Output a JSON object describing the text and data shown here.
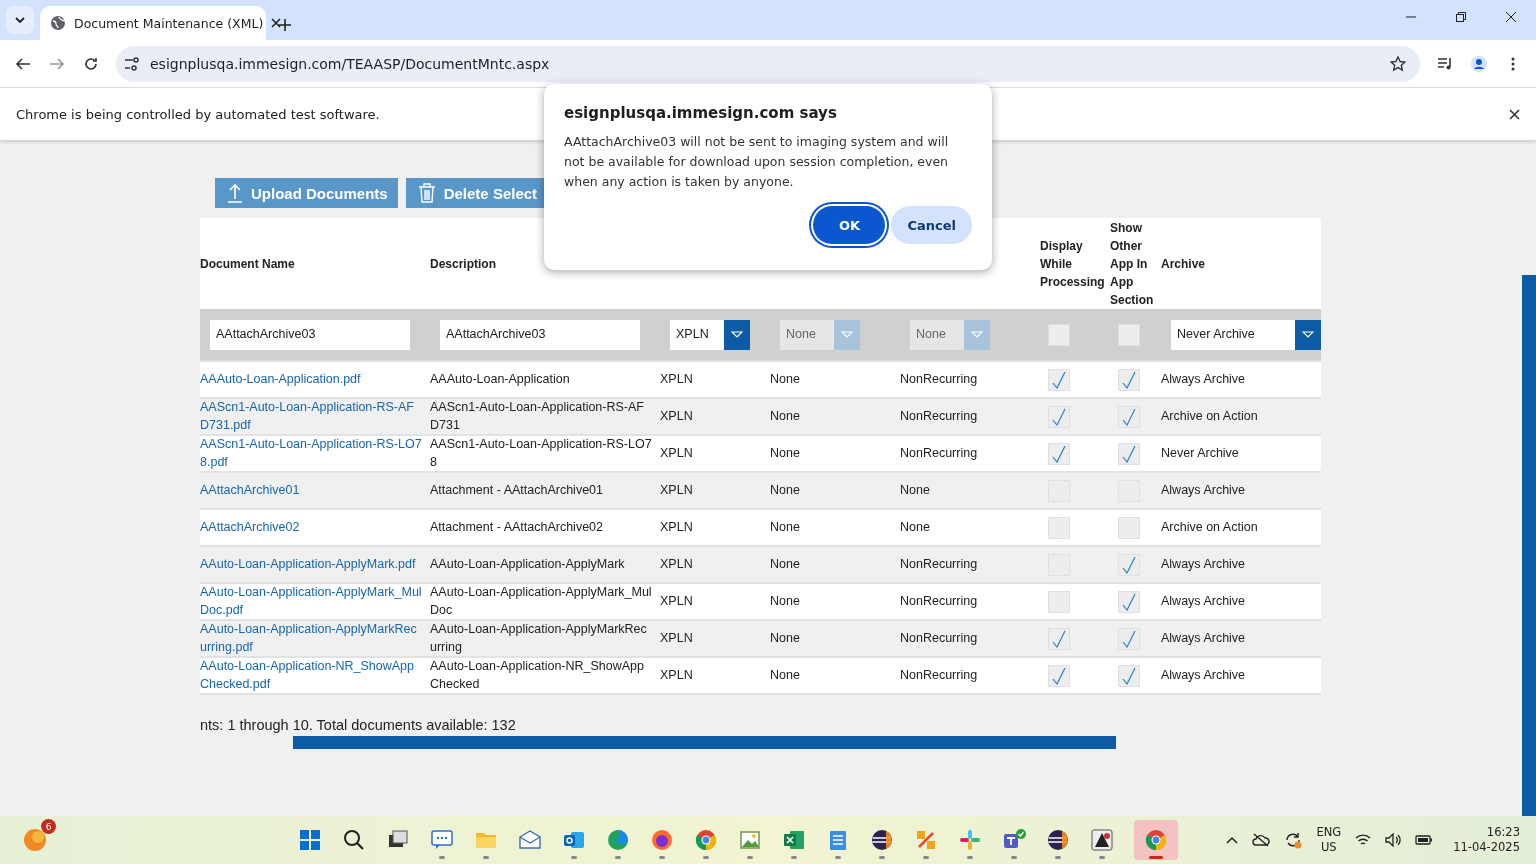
{
  "browser": {
    "tab_title": "Document Maintenance (XML)",
    "address": "esignplusqa.immesign.com/TEAASP/DocumentMntc.aspx",
    "infobar": "Chrome is being controlled by automated test software."
  },
  "actions": [
    {
      "label": "Upload Documents",
      "kind": "upload"
    },
    {
      "label": "Delete Select",
      "kind": "delete"
    }
  ],
  "table": {
    "columns": [
      {
        "label": "Document Name"
      },
      {
        "label": "Description"
      },
      {},
      {},
      {},
      {
        "label": "Display While Processing"
      },
      {
        "label": "Show Other App In App Section"
      },
      {
        "label": "Archive"
      }
    ],
    "filter": {
      "name": "AAttachArchive03",
      "description": "AAttachArchive03",
      "type": {
        "value": "XPLN",
        "disabled": false
      },
      "column_4": {
        "value": "None",
        "disabled": true
      },
      "column_5": {
        "value": "None",
        "disabled": true
      },
      "display": false,
      "show_other": false,
      "archive": {
        "value": "Never Archive",
        "disabled": false
      }
    },
    "rows": [
      {
        "name": "AAAuto-Loan-Application.pdf",
        "description": "AAAuto-Loan-Application",
        "type": "XPLN",
        "column_4": "None",
        "column_5": "NonRecurring",
        "display": true,
        "show_other": true,
        "archive": "Always Archive"
      },
      {
        "name": "AAScn1-Auto-Loan-Application-RS-AFD731.pdf",
        "description": "AAScn1-Auto-Loan-Application-RS-AFD731",
        "type": "XPLN",
        "column_4": "None",
        "column_5": "NonRecurring",
        "display": true,
        "show_other": true,
        "archive": "Archive on Action"
      },
      {
        "name": "AAScn1-Auto-Loan-Application-RS-LO78.pdf",
        "description": "AAScn1-Auto-Loan-Application-RS-LO78",
        "type": "XPLN",
        "column_4": "None",
        "column_5": "NonRecurring",
        "display": true,
        "show_other": true,
        "archive": "Never Archive"
      },
      {
        "name": "AAttachArchive01",
        "description": "Attachment - AAttachArchive01",
        "type": "XPLN",
        "column_4": "None",
        "column_5": "None",
        "display": false,
        "show_other": false,
        "archive": "Always Archive"
      },
      {
        "name": "AAttachArchive02",
        "description": "Attachment - AAttachArchive02",
        "type": "XPLN",
        "column_4": "None",
        "column_5": "None",
        "display": false,
        "show_other": false,
        "archive": "Archive on Action"
      },
      {
        "name": "AAuto-Loan-Application-ApplyMark.pdf",
        "description": "AAuto-Loan-Application-ApplyMark",
        "type": "XPLN",
        "column_4": "None",
        "column_5": "NonRecurring",
        "display": false,
        "show_other": true,
        "archive": "Always Archive"
      },
      {
        "name": "AAuto-Loan-Application-ApplyMark_MulDoc.pdf",
        "description": "AAuto-Loan-Application-ApplyMark_MulDoc",
        "type": "XPLN",
        "column_4": "None",
        "column_5": "NonRecurring",
        "display": false,
        "show_other": true,
        "archive": "Always Archive"
      },
      {
        "name": "AAuto-Loan-Application-ApplyMarkRecurring.pdf",
        "description": "AAuto-Loan-Application-ApplyMarkRecurring",
        "type": "XPLN",
        "column_4": "None",
        "column_5": "NonRecurring",
        "display": true,
        "show_other": true,
        "archive": "Always Archive"
      },
      {
        "name": "AAuto-Loan-Application-NR_ShowAppChecked.pdf",
        "description": "AAuto-Loan-Application-NR_ShowAppChecked",
        "type": "XPLN",
        "column_4": "None",
        "column_5": "NonRecurring",
        "display": true,
        "show_other": true,
        "archive": "Always Archive"
      }
    ]
  },
  "footer": "nts: 1 through 10. Total documents available: 132",
  "dialog": {
    "title": "esignplusqa.immesign.com says",
    "message": "AAttachArchive03 will not be sent to imaging system and will not be available for download upon session completion, even when any action is taken by anyone.",
    "buttons": [
      {
        "label": "OK",
        "selected": true
      },
      {
        "label": "Cancel",
        "selected": false
      }
    ]
  },
  "taskbar": {
    "notification_badge": "6",
    "apps": [
      {
        "kind": "start",
        "running": false
      },
      {
        "kind": "search",
        "running": false
      },
      {
        "kind": "taskview",
        "running": false
      },
      {
        "kind": "chat",
        "running": true
      },
      {
        "kind": "folder",
        "running": true
      },
      {
        "kind": "mail",
        "running": false
      },
      {
        "kind": "outlook",
        "running": true
      },
      {
        "kind": "edge",
        "running": true
      },
      {
        "kind": "firefox",
        "running": true
      },
      {
        "kind": "chrome",
        "running": true
      },
      {
        "kind": "picture",
        "running": true
      },
      {
        "kind": "excel",
        "running": true
      },
      {
        "kind": "notepad",
        "running": true
      },
      {
        "kind": "eclipse",
        "running": true
      },
      {
        "kind": "tools",
        "running": true
      },
      {
        "kind": "slack",
        "running": true
      },
      {
        "kind": "teams",
        "running": true
      },
      {
        "kind": "eclipse",
        "running": true
      },
      {
        "kind": "inkscape",
        "running": true
      },
      {
        "kind": "chrome",
        "running": true,
        "selected": true
      }
    ],
    "language": "ENG",
    "region": "US",
    "time": "16:23",
    "date": "11-04-2025"
  }
}
